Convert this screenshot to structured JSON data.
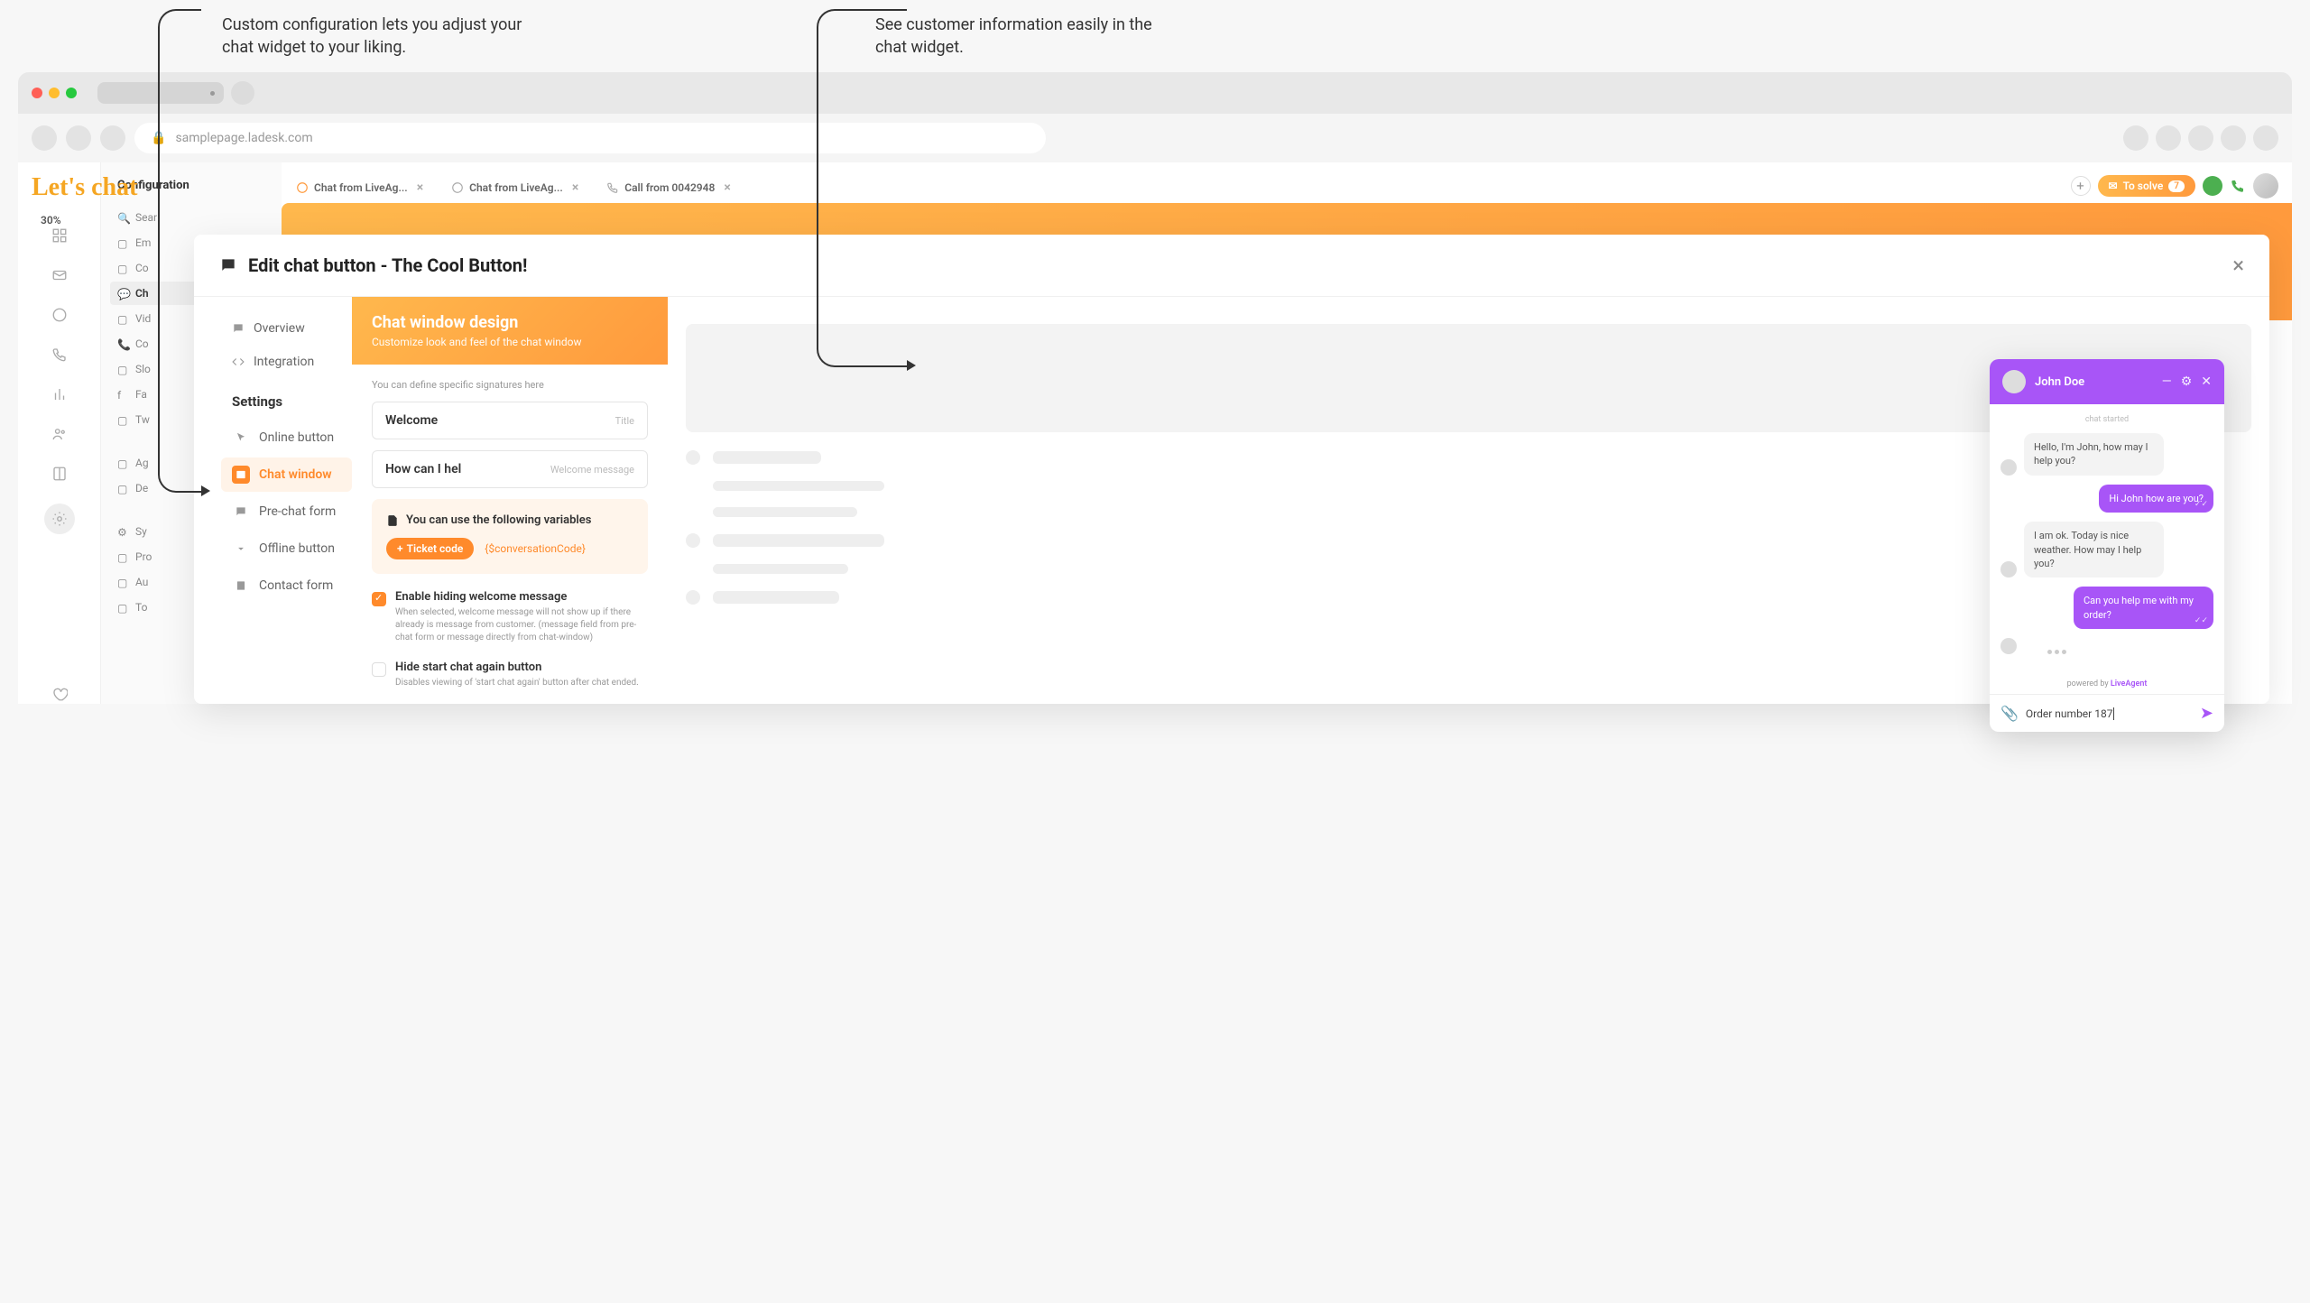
{
  "annotations": {
    "left": "Custom configuration lets you adjust your chat widget to your liking.",
    "right": "See customer information easily in the chat widget."
  },
  "browser": {
    "url": "samplepage.ladesk.com"
  },
  "app": {
    "logo": "Let's chat",
    "railPercent": "30%",
    "tabs": [
      {
        "icon": "chat",
        "label": "Chat from LiveAg..."
      },
      {
        "icon": "chat",
        "label": "Chat from LiveAg..."
      },
      {
        "icon": "phone",
        "label": "Call from 0042948"
      }
    ],
    "toSolve": {
      "label": "To solve",
      "count": "7"
    }
  },
  "configSidebar": {
    "title": "Configuration",
    "search": "Sear",
    "items": [
      "Em",
      "Co",
      "Ch",
      "Vid",
      "Co",
      "Slo",
      "Fa",
      "Tw"
    ],
    "lower": [
      "Ag",
      "De"
    ],
    "bottom": [
      "Sy",
      "Pro",
      "Au",
      "To"
    ]
  },
  "modal": {
    "title": "Edit chat button - The Cool Button!",
    "sidebar": {
      "overview": "Overview",
      "integration": "Integration",
      "settingsHeading": "Settings",
      "items": {
        "onlineButton": "Online button",
        "chatWindow": "Chat window",
        "preChatForm": "Pre-chat form",
        "offlineButton": "Offline button",
        "contactForm": "Contact form"
      }
    },
    "design": {
      "title": "Chat window design",
      "subtitle": "Customize look and feel of the chat window",
      "hint": "You can define specific signatures here",
      "titleField": {
        "value": "Welcome",
        "label": "Title"
      },
      "welcomeField": {
        "value": "How can I hel",
        "label": "Welcome message"
      },
      "variables": {
        "title": "You can use the following variables",
        "ticketCode": "Ticket code",
        "varExample": "{$conversationCode}"
      },
      "checkbox1": {
        "label": "Enable hiding welcome message",
        "desc": "When selected, welcome message will not show up if there already is message from customer. (message field from pre-chat form or message directly from chat-window)"
      },
      "checkbox2": {
        "label": "Hide start chat again button",
        "desc": "Disables viewing of 'start chat again' button after chat ended."
      }
    }
  },
  "chatWidget": {
    "name": "John Doe",
    "started": "chat started",
    "messages": {
      "m1": "Hello, I'm John, how may I help you?",
      "m2": "Hi John how are you?",
      "m3": "I am ok. Today is nice weather. How may I help you?",
      "m4": "Can you help me with my order?"
    },
    "poweredPrefix": "powered by ",
    "poweredBrand": "LiveAgent",
    "inputText": "Order number 187"
  }
}
